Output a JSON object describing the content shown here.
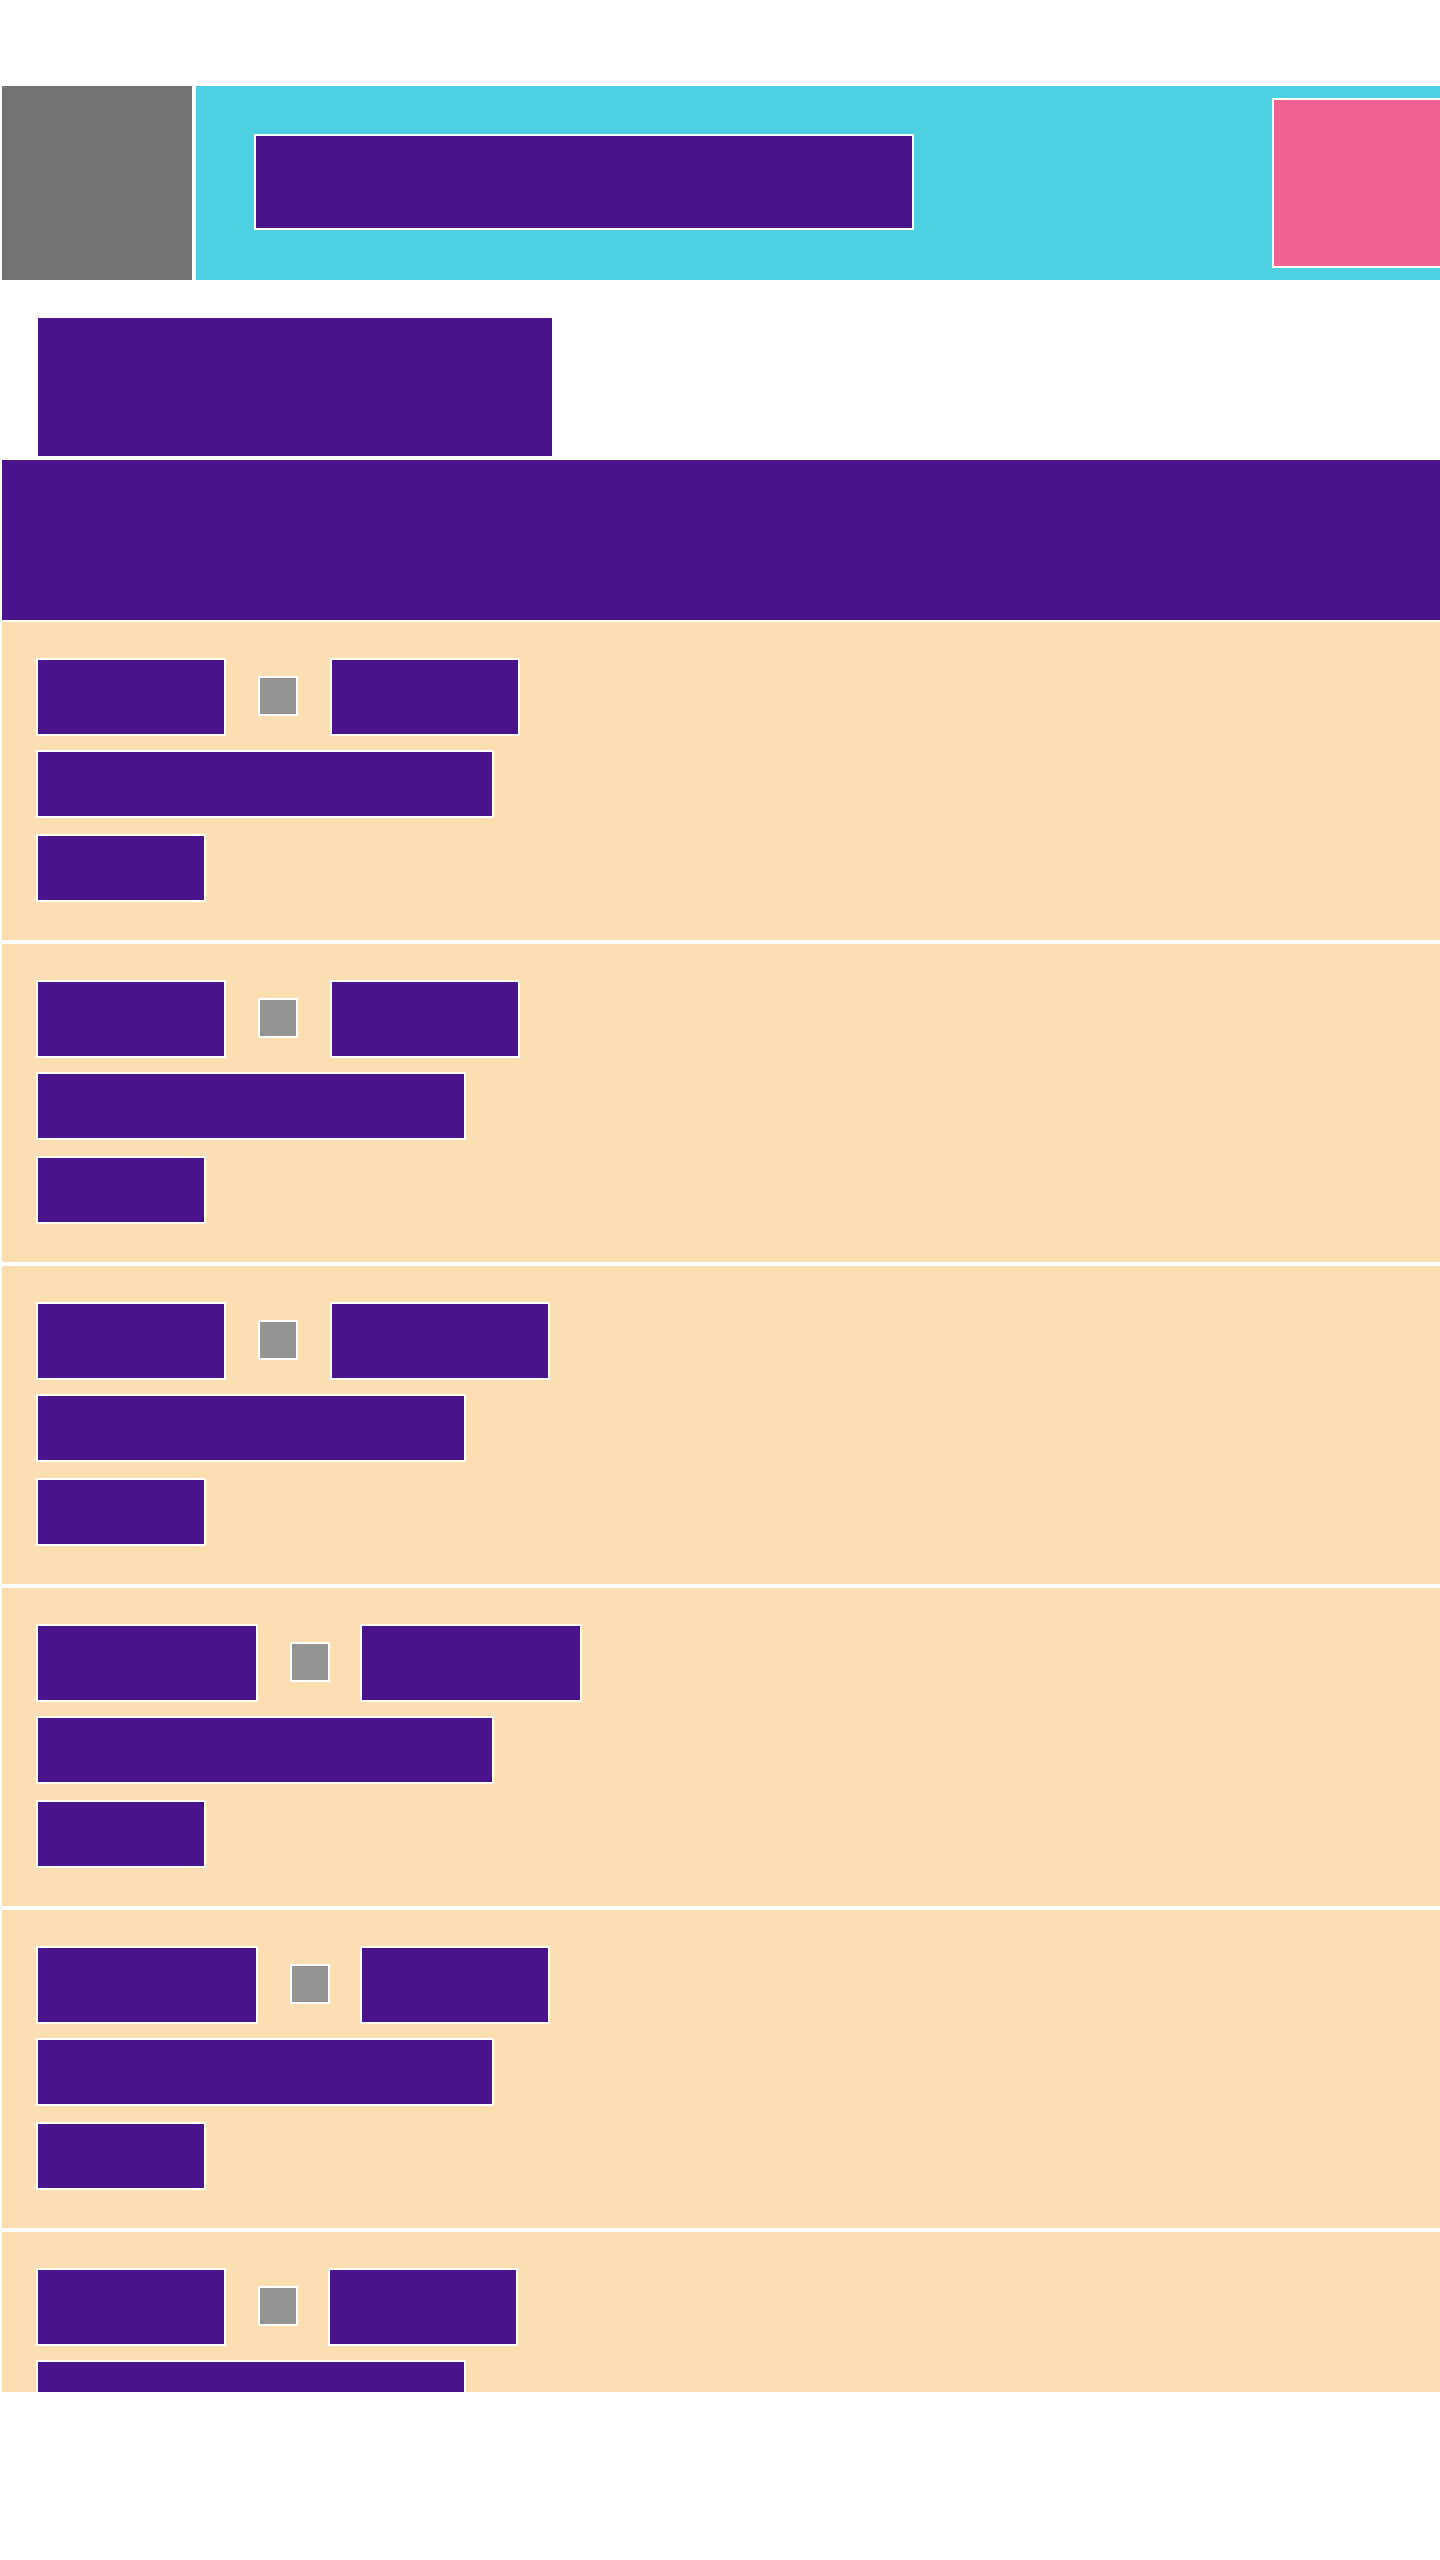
{
  "header": {
    "title": "",
    "nav_icon": "menu-icon",
    "action_icon": "action-icon"
  },
  "page": {
    "title": ""
  },
  "banner": {
    "text": ""
  },
  "list": {
    "items": [
      {
        "from": "",
        "to": "",
        "subtitle": "",
        "meta": ""
      },
      {
        "from": "",
        "to": "",
        "subtitle": "",
        "meta": ""
      },
      {
        "from": "",
        "to": "",
        "subtitle": "",
        "meta": ""
      },
      {
        "from": "",
        "to": "",
        "subtitle": "",
        "meta": ""
      },
      {
        "from": "",
        "to": "",
        "subtitle": "",
        "meta": ""
      },
      {
        "from": "",
        "to": "",
        "subtitle": "",
        "meta": ""
      }
    ],
    "separator_icon": "arrow-right-icon"
  },
  "colors": {
    "header_bg": "#4dd0e1",
    "nav_button": "#737373",
    "action_button": "#f06292",
    "primary": "#4a148c",
    "list_item_bg": "#fcdeb3",
    "icon_placeholder": "#949494",
    "background": "#ffffff"
  }
}
